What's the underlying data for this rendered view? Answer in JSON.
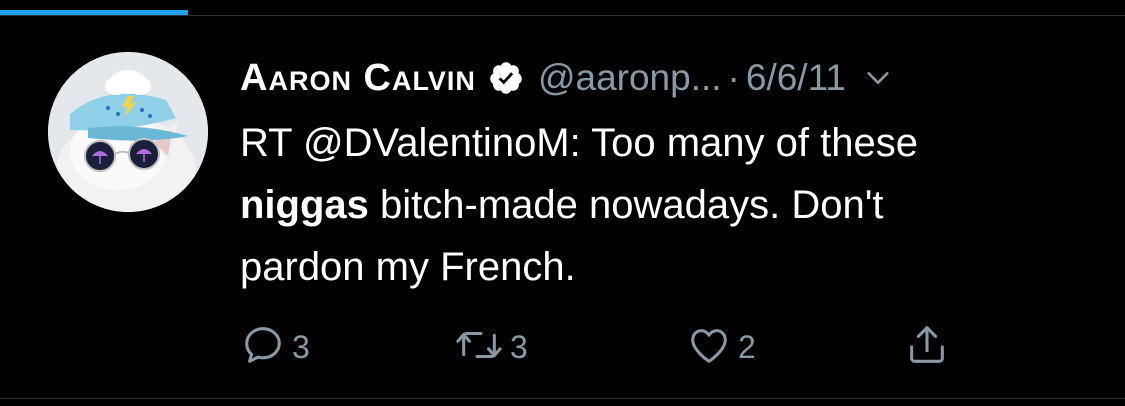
{
  "tweet": {
    "display_name": "Aaron Calvin",
    "handle": "@aaronp...",
    "separator": "·",
    "date": "6/6/11",
    "text_line1": "RT @DValentinoM: Too many of these",
    "text_bold": "niggas",
    "text_line2_rest": " bitch-made nowadays. Don't",
    "text_line3": "pardon my French."
  },
  "actions": {
    "replies": "3",
    "retweets": "3",
    "likes": "2"
  },
  "icons": {
    "verified": "verified-badge-icon",
    "more": "chevron-down-icon",
    "reply": "reply-icon",
    "retweet": "retweet-icon",
    "like": "heart-icon",
    "share": "share-icon"
  },
  "colors": {
    "background": "#000000",
    "text": "#ffffff",
    "secondary": "#8899a6",
    "accent": "#1da1f2"
  }
}
